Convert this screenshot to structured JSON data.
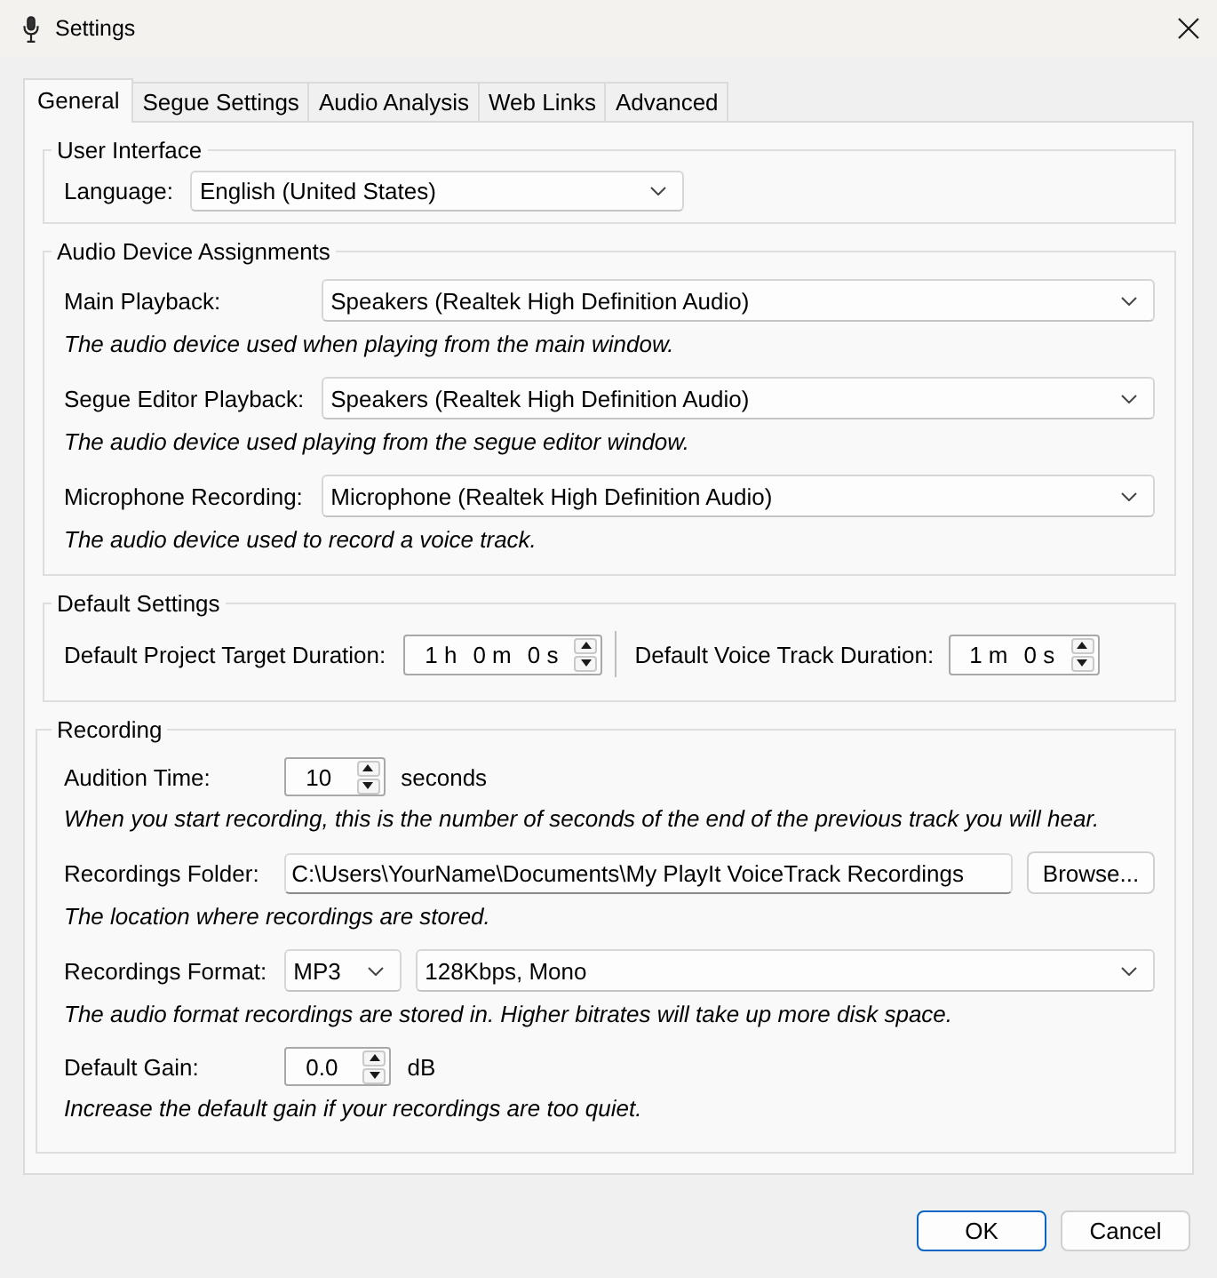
{
  "window": {
    "title": "Settings"
  },
  "tabs": [
    {
      "label": "General",
      "selected": true
    },
    {
      "label": "Segue Settings",
      "selected": false
    },
    {
      "label": "Audio Analysis",
      "selected": false
    },
    {
      "label": "Web Links",
      "selected": false
    },
    {
      "label": "Advanced",
      "selected": false
    }
  ],
  "groups": [
    {
      "title": "User Interface",
      "rows": [
        {
          "label": "Language:",
          "controls": [
            {
              "kind": "dropdown",
              "value": "English (United States)"
            }
          ]
        }
      ]
    },
    {
      "title": "Audio Device Assignments",
      "rows": [
        {
          "label": "Main Playback:",
          "controls": [
            {
              "kind": "dropdown",
              "value": "Speakers (Realtek High Definition Audio)"
            }
          ],
          "hint": "The audio device used when playing from the main window."
        },
        {
          "label": "Segue Editor Playback:",
          "controls": [
            {
              "kind": "dropdown",
              "value": "Speakers (Realtek High Definition Audio)"
            }
          ],
          "hint": "The audio device used playing from the segue editor window."
        },
        {
          "label": "Microphone Recording:",
          "controls": [
            {
              "kind": "dropdown",
              "value": "Microphone (Realtek High Definition Audio)"
            }
          ],
          "hint": "The audio device used to record a voice track."
        }
      ]
    },
    {
      "title": "Default Settings",
      "rows": [
        {
          "label": "Default Project Target Duration:",
          "controls": [
            {
              "kind": "duration",
              "parts": [
                "1 h",
                "0 m",
                "0 s"
              ]
            },
            {
              "kind": "separator"
            },
            {
              "kind": "label",
              "text": "Default Voice Track Duration:"
            },
            {
              "kind": "duration",
              "parts": [
                "1 m",
                "0 s"
              ]
            }
          ]
        }
      ]
    },
    {
      "title": "Recording",
      "rows": [
        {
          "label": "Audition Time:",
          "controls": [
            {
              "kind": "spinner",
              "value": "10"
            },
            {
              "kind": "unit",
              "text": "seconds"
            }
          ],
          "hint": "When you start recording, this is the number of seconds of the end of the previous track you will hear."
        },
        {
          "label": "Recordings Folder:",
          "controls": [
            {
              "kind": "text_field",
              "value": "C:\\Users\\YourName\\Documents\\My PlayIt VoiceTrack Recordings"
            },
            {
              "kind": "button",
              "label": "Browse..."
            }
          ],
          "hint": "The location where recordings are stored."
        },
        {
          "label": "Recordings Format:",
          "controls": [
            {
              "kind": "dropdown",
              "value": "MP3"
            },
            {
              "kind": "dropdown",
              "value": "128Kbps, Mono"
            }
          ],
          "hint": "The audio format recordings are stored in. Higher bitrates will take up more disk space."
        },
        {
          "label": "Default Gain:",
          "controls": [
            {
              "kind": "spinner",
              "value": "0.0"
            },
            {
              "kind": "unit",
              "text": "dB"
            }
          ],
          "hint": "Increase the default gain if your recordings are too quiet."
        }
      ]
    }
  ],
  "buttons": [
    {
      "label": "OK",
      "default": true
    },
    {
      "label": "Cancel",
      "default": false
    }
  ]
}
